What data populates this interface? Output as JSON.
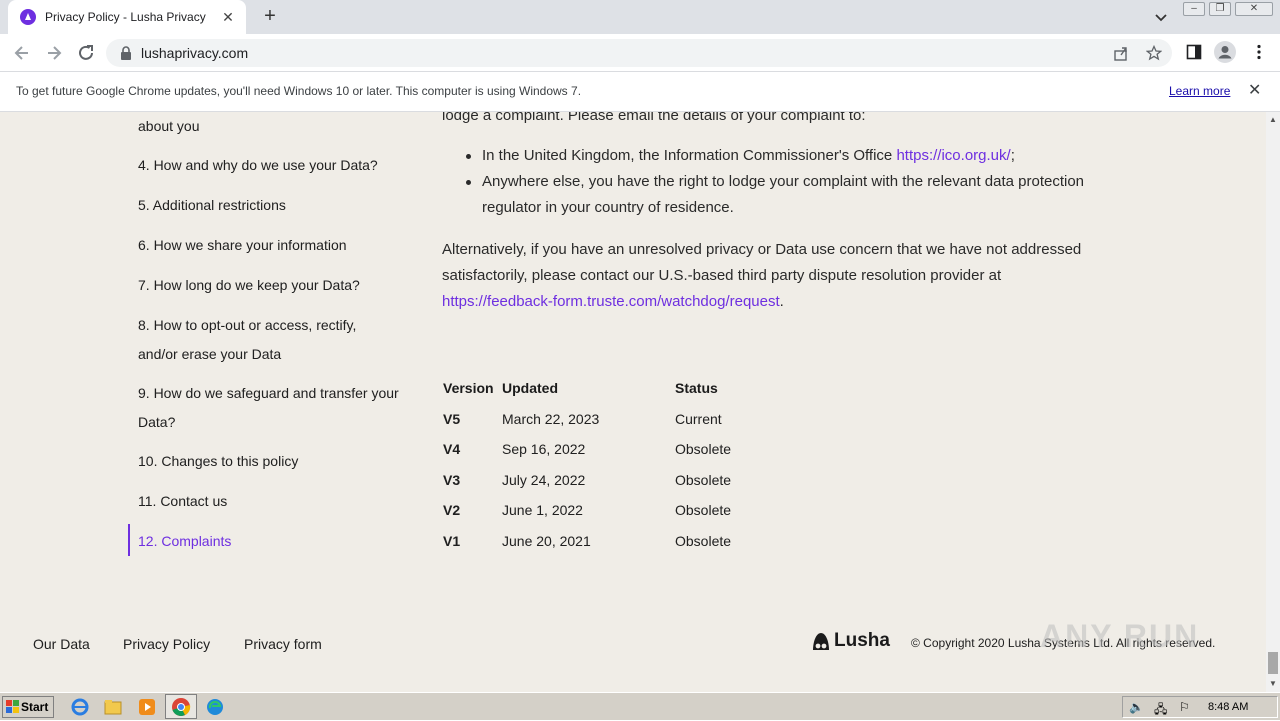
{
  "browser": {
    "tab_title": "Privacy Policy - Lusha Privacy",
    "url": "lushaprivacy.com",
    "infobar_text": "To get future Google Chrome updates, you'll need Windows 10 or later. This computer is using Windows 7.",
    "infobar_link": "Learn more"
  },
  "toc": {
    "items": [
      {
        "label": "about you"
      },
      {
        "label": "4. How and why do we use your Data?"
      },
      {
        "label": "5. Additional restrictions"
      },
      {
        "label": "6. How we share your information"
      },
      {
        "label": "7. How long do we keep your Data?"
      },
      {
        "label": "8. How to opt-out or access, rectify,"
      },
      {
        "label": "and/or erase your Data"
      },
      {
        "label": "9. How do we safeguard and transfer your"
      },
      {
        "label": "Data?"
      },
      {
        "label": "10. Changes to this policy"
      },
      {
        "label": "11. Contact us"
      },
      {
        "label": "12. Complaints"
      }
    ],
    "active_color": "#6e2fe0"
  },
  "content": {
    "lead_line": "lodge a complaint. Please email the details of your complaint to:",
    "bullet1_text": "In the United Kingdom, the Information Commissioner's Office ",
    "bullet1_link": "https://ico.org.uk/",
    "bullet1_end": ";",
    "bullet2_line1": "Anywhere else, you have the right to lodge your complaint with the relevant data protection",
    "bullet2_line2": "regulator in your country of residence.",
    "para_line1": "Alternatively, if you have an unresolved privacy or Data use concern that we have not addressed",
    "para_line2": "satisfactorily, please contact our U.S.-based third party dispute resolution provider at",
    "para_link": "https://feedback-form.truste.com/watchdog/request",
    "para_end": "."
  },
  "versions": {
    "headers": {
      "version": "Version",
      "updated": "Updated",
      "status": "Status"
    },
    "rows": [
      {
        "version": "V5",
        "updated": "March 22, 2023",
        "status": "Current"
      },
      {
        "version": "V4",
        "updated": "Sep 16, 2022",
        "status": "Obsolete"
      },
      {
        "version": "V3",
        "updated": "July 24, 2022",
        "status": "Obsolete"
      },
      {
        "version": "V2",
        "updated": "June 1, 2022",
        "status": "Obsolete"
      },
      {
        "version": "V1",
        "updated": "June 20, 2021",
        "status": "Obsolete"
      }
    ]
  },
  "footer": {
    "links": [
      "Our Data",
      "Privacy Policy",
      "Privacy form"
    ],
    "brand": "Lusha",
    "copyright": "© Copyright 2020 Lusha Systems Ltd. All rights reserved."
  },
  "watermark": "ANY RUN",
  "taskbar": {
    "start_label": "Start",
    "clock": "8:48 AM"
  }
}
